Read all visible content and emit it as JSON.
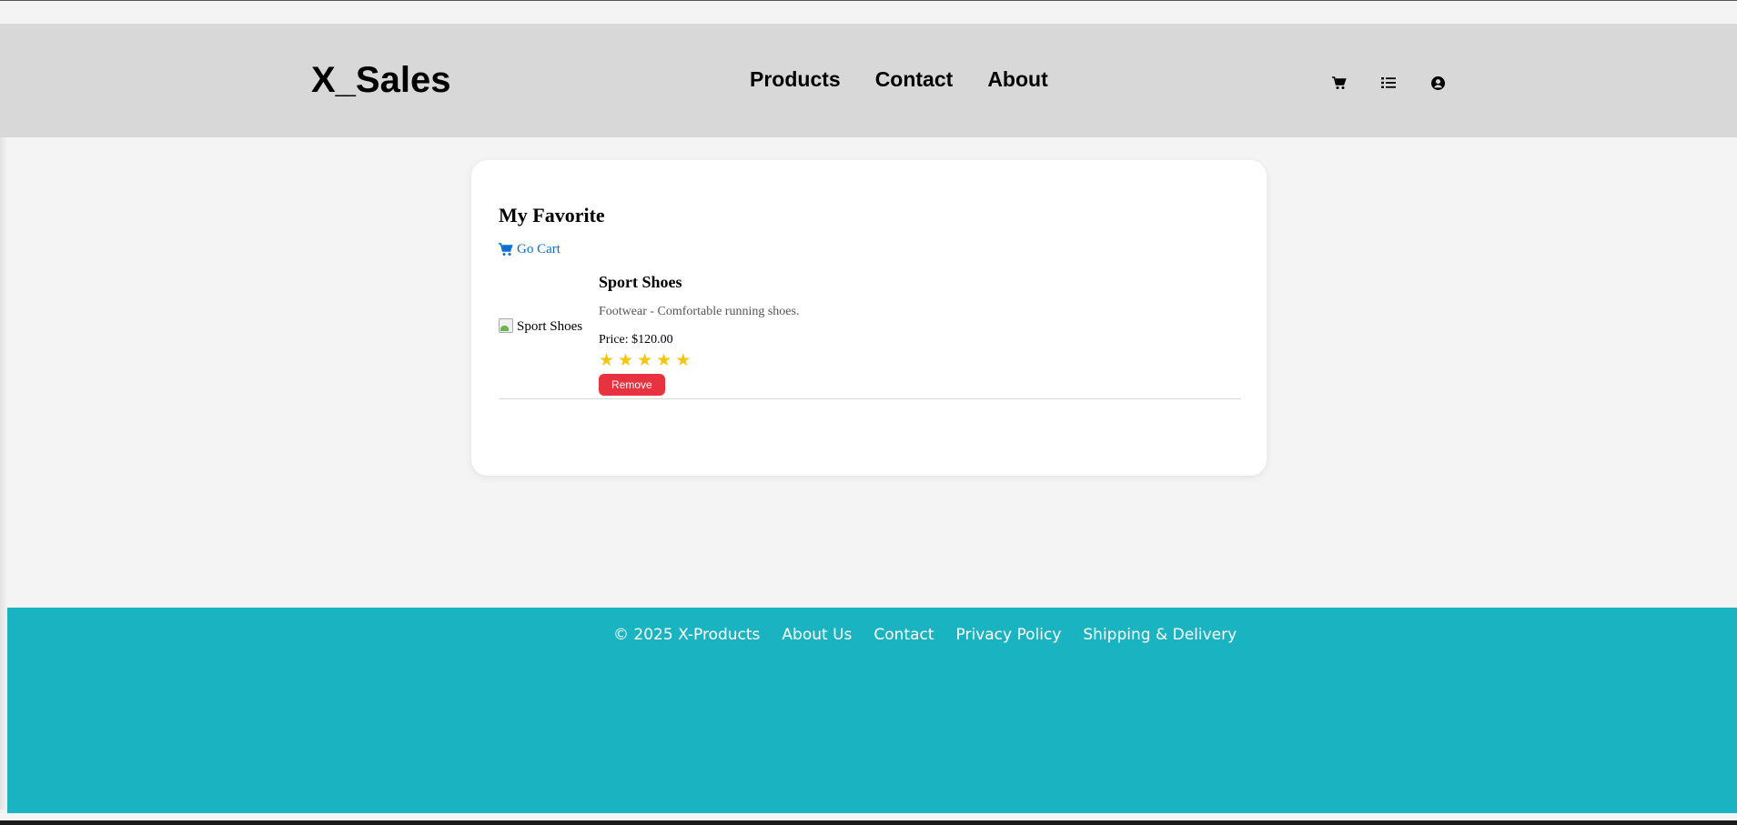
{
  "header": {
    "logo": "X_Sales",
    "nav": [
      {
        "label": "Products"
      },
      {
        "label": "Contact"
      },
      {
        "label": "About"
      }
    ],
    "icons": [
      "cart-icon",
      "list-icon",
      "user-circle-icon"
    ]
  },
  "favorites": {
    "title": "My Favorite",
    "go_cart_label": "Go Cart",
    "items": [
      {
        "image_alt": "Sport Shoes",
        "name": "Sport Shoes",
        "description": "Footwear - Comfortable running shoes.",
        "price": "Price: $120.00",
        "rating": 5,
        "remove_label": "Remove"
      }
    ]
  },
  "footer": {
    "copyright": "© 2025 X-Products",
    "links": [
      {
        "label": "About Us"
      },
      {
        "label": "Contact"
      },
      {
        "label": "Privacy Policy"
      },
      {
        "label": "Shipping & Delivery"
      }
    ]
  },
  "colors": {
    "header_bg": "#d8d8d8",
    "footer_bg": "#1ab3c1",
    "link": "#0a6fd0",
    "remove_button": "#e8323f",
    "star": "#f5c60f"
  }
}
